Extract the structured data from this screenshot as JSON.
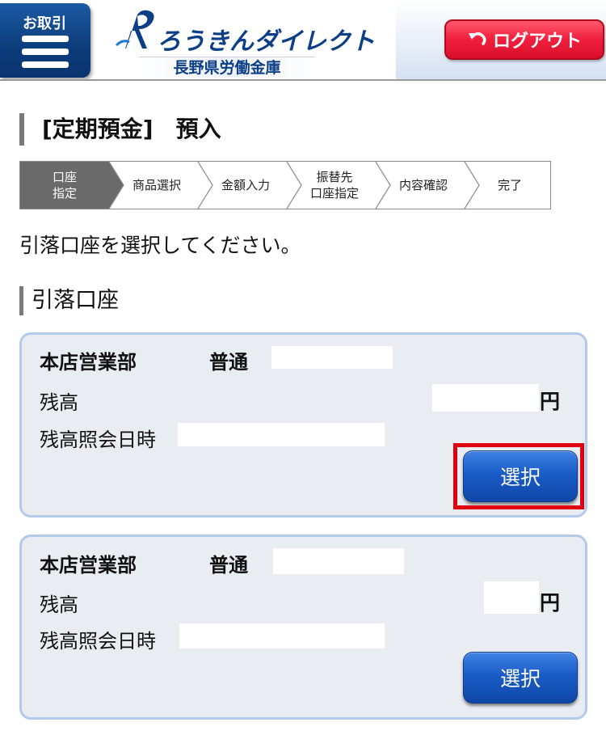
{
  "header": {
    "menu_label": "お取引",
    "logo_brand": "ろうきんダイレクト",
    "logo_bank": "長野県労働金庫",
    "logout_label": "ログアウト"
  },
  "page": {
    "title": "[定期預金]　預入"
  },
  "steps": [
    {
      "label": "口座\n指定",
      "active": true
    },
    {
      "label": "商品選択",
      "active": false
    },
    {
      "label": "金額入力",
      "active": false
    },
    {
      "label": "振替先\n口座指定",
      "active": false
    },
    {
      "label": "内容確認",
      "active": false
    },
    {
      "label": "完了",
      "active": false
    }
  ],
  "instruction": "引落口座を選択してください。",
  "section_title": "引落口座",
  "accounts": [
    {
      "branch": "本店営業部",
      "type": "普通",
      "balance_label": "残高",
      "currency": "円",
      "date_label": "残高照会日時",
      "select_label": "選択"
    },
    {
      "branch": "本店営業部",
      "type": "普通",
      "balance_label": "残高",
      "currency": "円",
      "date_label": "残高照会日時",
      "select_label": "選択"
    }
  ],
  "colors": {
    "header_navy": "#0d3f86",
    "logout_red": "#f01e3c",
    "select_blue": "#1a5cc6",
    "card_bg": "#e9ecf0",
    "card_border": "#b3cbe8",
    "highlight_red": "#e00010"
  },
  "icons": {
    "menu": "hamburger-icon",
    "logout": "undo-arrow-icon"
  }
}
